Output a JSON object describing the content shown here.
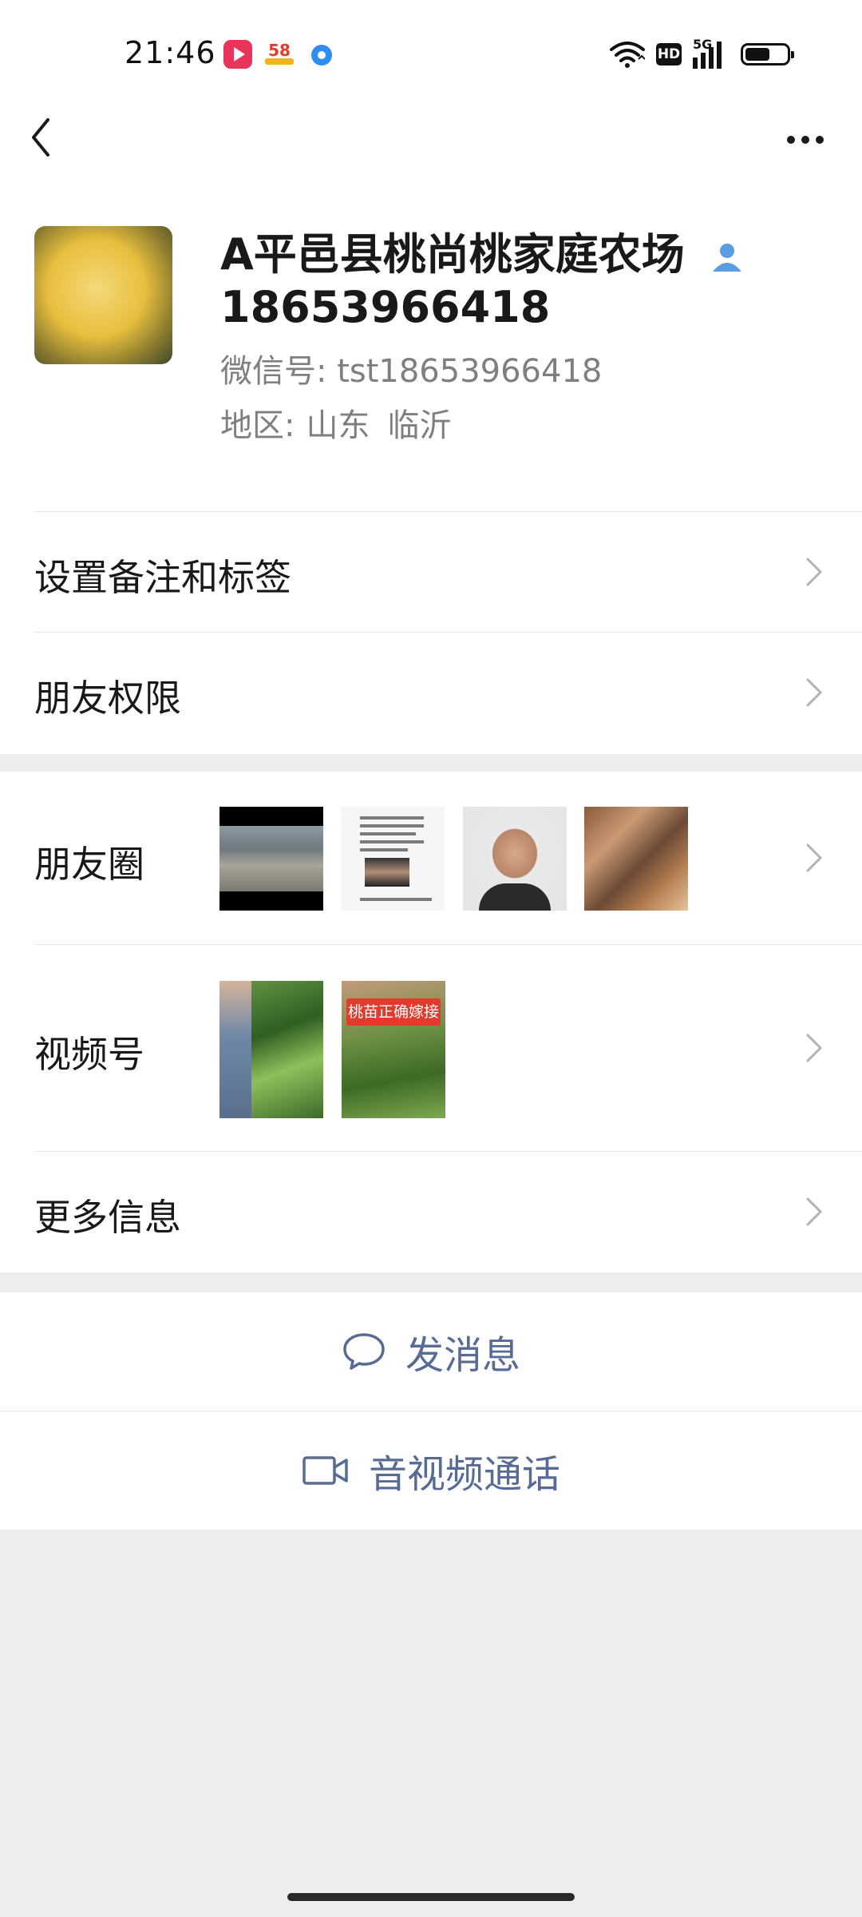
{
  "status_bar": {
    "time": "21:46",
    "app_icons": [
      "video-app-icon",
      "58-app-icon",
      "circle-app-icon"
    ],
    "app_58_label": "58",
    "hd_label": "HD",
    "network": "5G"
  },
  "nav": {
    "back_icon": "chevron-left-icon",
    "more_icon": "more-dots-icon"
  },
  "profile": {
    "name_line1": "A平邑县桃尚桃家庭农场",
    "name_line2": "18653966418",
    "wechat_id_label": "微信号:",
    "wechat_id": "tst18653966418",
    "region_label": "地区:",
    "region_province": "山东",
    "region_city": "临沂"
  },
  "rows": {
    "remark_label": "设置备注和标签",
    "permission_label": "朋友权限",
    "moments_label": "朋友圈",
    "channels_label": "视频号",
    "more_info_label": "更多信息"
  },
  "channels": {
    "tag_text": "桃苗正确嫁接"
  },
  "actions": {
    "message_label": "发消息",
    "call_label": "音视频通话"
  },
  "colors": {
    "link_blue": "#576b95",
    "background_gray": "#ededed",
    "verified_blue": "#5a9de0"
  }
}
